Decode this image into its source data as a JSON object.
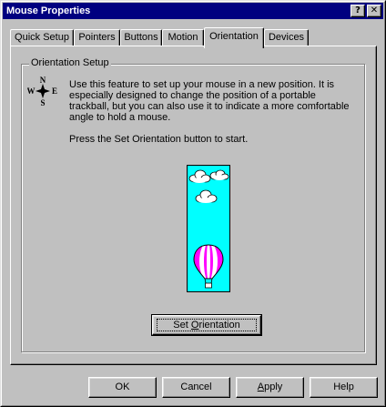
{
  "window": {
    "title": "Mouse Properties",
    "help_button": "?",
    "close_button": "✕"
  },
  "tabs": [
    {
      "label": "Quick Setup",
      "active": false
    },
    {
      "label": "Pointers",
      "active": false
    },
    {
      "label": "Buttons",
      "active": false
    },
    {
      "label": "Motion",
      "active": false
    },
    {
      "label": "Orientation",
      "active": true
    },
    {
      "label": "Devices",
      "active": false
    }
  ],
  "orientation": {
    "group_title": "Orientation Setup",
    "compass": {
      "n": "N",
      "s": "S",
      "e": "E",
      "w": "W"
    },
    "description": "Use this feature to set up your mouse in a new position.  It is especially designed to change the position of a portable trackball, but you can also use it to indicate a more comfortable angle to hold a mouse.",
    "instruction": "Press the Set Orientation button to start.",
    "set_button": {
      "before": "Set ",
      "mnemonic": "O",
      "after": "rientation"
    }
  },
  "footer": {
    "ok": "OK",
    "cancel": "Cancel",
    "apply": {
      "mnemonic": "A",
      "after": "pply"
    },
    "help": "Help"
  },
  "colors": {
    "title_bar": "#000080",
    "face": "#c0c0c0",
    "sky": "#00ffff",
    "balloon_stripe_magenta": "#ff00ff",
    "balloon_stripe_white": "#ffffff"
  }
}
